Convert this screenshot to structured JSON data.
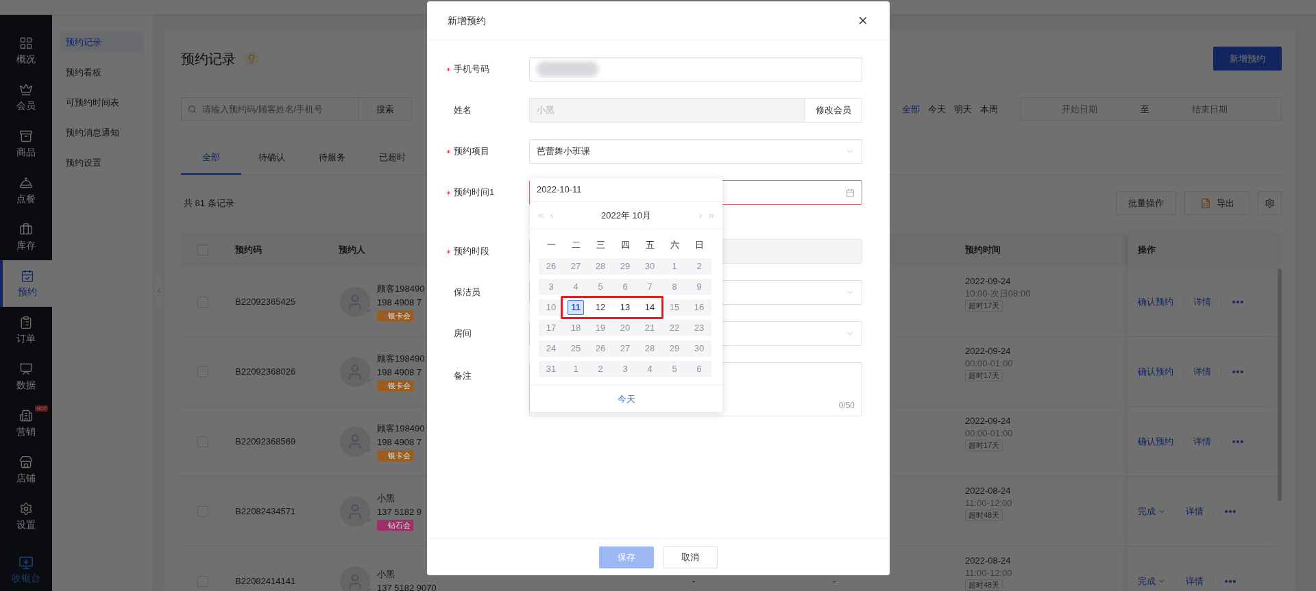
{
  "side_nav": [
    {
      "label": "概况",
      "selected": false
    },
    {
      "label": "会员",
      "selected": false
    },
    {
      "label": "商品",
      "selected": false
    },
    {
      "label": "点餐",
      "selected": false
    },
    {
      "label": "库存",
      "selected": false
    },
    {
      "label": "预约",
      "selected": true
    },
    {
      "label": "订单",
      "selected": false
    },
    {
      "label": "数据",
      "selected": false
    },
    {
      "label": "营销",
      "selected": false,
      "badge": "HOT"
    },
    {
      "label": "店铺",
      "selected": false
    },
    {
      "label": "设置",
      "selected": false
    }
  ],
  "cashier": {
    "label": "收银台"
  },
  "sub_nav": [
    {
      "label": "预约记录",
      "selected": true
    },
    {
      "label": "预约看板",
      "selected": false
    },
    {
      "label": "可预约时间表",
      "selected": false
    },
    {
      "label": "预约消息通知",
      "selected": false
    },
    {
      "label": "预约设置",
      "selected": false
    }
  ],
  "page": {
    "title": "预约记录",
    "new_button": "新增预约",
    "search": {
      "placeholder": "请输入预约码/顾客姓名/手机号",
      "button": "搜索"
    },
    "quick_filters": [
      {
        "label": "全部",
        "selected": true
      },
      {
        "label": "今天",
        "selected": false
      },
      {
        "label": "明天",
        "selected": false
      },
      {
        "label": "本周",
        "selected": false
      }
    ],
    "date_range": {
      "start_placeholder": "开始日期",
      "separator": "至",
      "end_placeholder": "结束日期"
    },
    "tabs": [
      {
        "label": "全部",
        "selected": true
      },
      {
        "label": "待确认",
        "selected": false
      },
      {
        "label": "待服务",
        "selected": false
      },
      {
        "label": "已超时",
        "selected": false
      }
    ],
    "record_count": "共 81 条记录",
    "batch_button": "批量操作",
    "export_button": "导出"
  },
  "table": {
    "select_all": {
      "checked": false
    },
    "columns": {
      "code": "预约码",
      "person": "预约人",
      "time": "预约时间",
      "actions": "操作"
    },
    "rows": [
      {
        "checked": false,
        "code": "B22092365425",
        "gender": "♂",
        "name": "顾客198490",
        "phone": "198 4908 7",
        "badge": {
          "text": "银卡会",
          "color": "#9a5e22"
        },
        "date": "2022-09-24",
        "time_range": "10:00-次日08:00",
        "overdue": "超时17天",
        "actions": [
          {
            "kind": "link",
            "label": "确认预约"
          },
          {
            "kind": "link",
            "label": "详情"
          },
          {
            "kind": "more"
          }
        ]
      },
      {
        "checked": false,
        "code": "B22092368026",
        "gender": "♂",
        "name": "顾客198490",
        "phone": "198 4908 7",
        "badge": {
          "text": "银卡会",
          "color": "#9a5e22"
        },
        "date": "2022-09-24",
        "time_range": "00:00-01:00",
        "overdue": "超时17天",
        "actions": [
          {
            "kind": "link",
            "label": "确认预约"
          },
          {
            "kind": "link",
            "label": "详情"
          },
          {
            "kind": "more"
          }
        ]
      },
      {
        "checked": false,
        "code": "B22092368569",
        "gender": "♂",
        "name": "顾客198490",
        "phone": "198 4908 7",
        "badge": {
          "text": "银卡会",
          "color": "#9a5e22"
        },
        "date": "2022-09-24",
        "time_range": "00:00-01:00",
        "overdue": "超时17天",
        "actions": [
          {
            "kind": "link",
            "label": "确认预约"
          },
          {
            "kind": "link",
            "label": "详情"
          },
          {
            "kind": "more"
          }
        ]
      },
      {
        "checked": false,
        "code": "B22082434571",
        "gender": "♂",
        "name": "小黑",
        "phone": "137 5182 9",
        "badge": {
          "text": "钻石会",
          "color": "#9c3068"
        },
        "date": "2022-08-24",
        "time_range": "11:00-12:00",
        "overdue": "超时48天",
        "actions": [
          {
            "kind": "dropdown",
            "label": "完成"
          },
          {
            "kind": "link",
            "label": "详情"
          },
          {
            "kind": "more"
          }
        ]
      },
      {
        "checked": false,
        "code": "B22082414141",
        "gender": "♂",
        "name": "小黑",
        "phone": "137 5182 9070",
        "column_4": "-",
        "column_5": "-",
        "date": "2022-08-24",
        "time_range": "11:00-12:00",
        "overdue": "超时48天",
        "actions": [
          {
            "kind": "dropdown",
            "label": "完成"
          },
          {
            "kind": "link",
            "label": "详情"
          },
          {
            "kind": "more"
          }
        ]
      }
    ]
  },
  "modal": {
    "title": "新增预约",
    "fields": [
      {
        "kind": "text",
        "label": "手机号码",
        "required": true,
        "blurred": true
      },
      {
        "kind": "member",
        "label": "姓名",
        "required": false,
        "value": "小黑",
        "disabled": true,
        "button": "修改会员"
      },
      {
        "kind": "select",
        "label": "预约项目",
        "required": true,
        "value": "芭蕾舞小班课"
      },
      {
        "kind": "date",
        "label": "预约时间1",
        "required": true,
        "error": true
      },
      {
        "kind": "text",
        "label": "预约时段",
        "required": true,
        "disabled": true
      },
      {
        "kind": "select",
        "label": "保洁员",
        "required": false
      },
      {
        "kind": "select",
        "label": "房间",
        "required": false
      },
      {
        "kind": "textarea",
        "label": "备注",
        "required": false,
        "counter": "0/50"
      }
    ],
    "save_button": {
      "label": "保存",
      "disabled": true
    },
    "cancel_button": "取消"
  },
  "calendar": {
    "input": "2022-10-11",
    "month_title": "2022年 10月",
    "weekdays": [
      "一",
      "二",
      "三",
      "四",
      "五",
      "六",
      "日"
    ],
    "weeks": [
      [
        {
          "day": "26",
          "disabled": true,
          "selected": false
        },
        {
          "day": "27",
          "disabled": true,
          "selected": false
        },
        {
          "day": "28",
          "disabled": true,
          "selected": false
        },
        {
          "day": "29",
          "disabled": true,
          "selected": false
        },
        {
          "day": "30",
          "disabled": true,
          "selected": false
        },
        {
          "day": "1",
          "disabled": true,
          "selected": false
        },
        {
          "day": "2",
          "disabled": true,
          "selected": false
        }
      ],
      [
        {
          "day": "3",
          "disabled": true,
          "selected": false
        },
        {
          "day": "4",
          "disabled": true,
          "selected": false
        },
        {
          "day": "5",
          "disabled": true,
          "selected": false
        },
        {
          "day": "6",
          "disabled": true,
          "selected": false
        },
        {
          "day": "7",
          "disabled": true,
          "selected": false
        },
        {
          "day": "8",
          "disabled": true,
          "selected": false
        },
        {
          "day": "9",
          "disabled": true,
          "selected": false
        }
      ],
      [
        {
          "day": "10",
          "disabled": true,
          "selected": false
        },
        {
          "day": "11",
          "disabled": false,
          "selected": true
        },
        {
          "day": "12",
          "disabled": false,
          "selected": false
        },
        {
          "day": "13",
          "disabled": false,
          "selected": false
        },
        {
          "day": "14",
          "disabled": false,
          "selected": false
        },
        {
          "day": "15",
          "disabled": true,
          "selected": false
        },
        {
          "day": "16",
          "disabled": true,
          "selected": false
        }
      ],
      [
        {
          "day": "17",
          "disabled": true,
          "selected": false
        },
        {
          "day": "18",
          "disabled": true,
          "selected": false
        },
        {
          "day": "19",
          "disabled": true,
          "selected": false
        },
        {
          "day": "20",
          "disabled": true,
          "selected": false
        },
        {
          "day": "21",
          "disabled": true,
          "selected": false
        },
        {
          "day": "22",
          "disabled": true,
          "selected": false
        },
        {
          "day": "23",
          "disabled": true,
          "selected": false
        }
      ],
      [
        {
          "day": "24",
          "disabled": true,
          "selected": false
        },
        {
          "day": "25",
          "disabled": true,
          "selected": false
        },
        {
          "day": "26",
          "disabled": true,
          "selected": false
        },
        {
          "day": "27",
          "disabled": true,
          "selected": false
        },
        {
          "day": "28",
          "disabled": true,
          "selected": false
        },
        {
          "day": "29",
          "disabled": true,
          "selected": false
        },
        {
          "day": "30",
          "disabled": true,
          "selected": false
        }
      ],
      [
        {
          "day": "31",
          "disabled": true,
          "selected": false
        },
        {
          "day": "1",
          "disabled": true,
          "selected": false
        },
        {
          "day": "2",
          "disabled": true,
          "selected": false
        },
        {
          "day": "3",
          "disabled": true,
          "selected": false
        },
        {
          "day": "4",
          "disabled": true,
          "selected": false
        },
        {
          "day": "5",
          "disabled": true,
          "selected": false
        },
        {
          "day": "6",
          "disabled": true,
          "selected": false
        }
      ]
    ],
    "today_link": "今天",
    "annotation": true
  }
}
